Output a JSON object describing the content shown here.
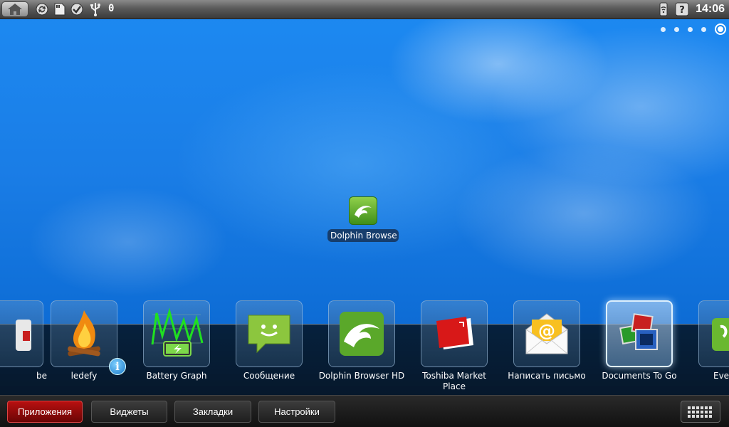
{
  "status_bar": {
    "icons": [
      "home-icon",
      "sync-icon",
      "sd-card-icon",
      "check-icon",
      "usb-icon"
    ],
    "notification_count": "0",
    "right_icons": [
      "wifi-icon",
      "help-icon"
    ],
    "clock": "14:06"
  },
  "home": {
    "page_count": 5,
    "active_page": 5
  },
  "desktop_shortcut": {
    "label": "Dolphin Browse",
    "icon": "dolphin-icon"
  },
  "dock": {
    "apps": [
      {
        "label": "be",
        "icon": "partial-app-icon"
      },
      {
        "label": "ledefy",
        "icon": "campfire-icon"
      },
      {
        "label": "Battery Graph",
        "icon": "battery-graph-icon"
      },
      {
        "label": "Сообщение",
        "icon": "message-icon"
      },
      {
        "label": "Dolphin Browser HD",
        "icon": "dolphin-icon"
      },
      {
        "label": "Toshiba Market Place",
        "icon": "market-icon"
      },
      {
        "label": "Написать письмо",
        "icon": "email-icon"
      },
      {
        "label": "Documents To Go",
        "icon": "documents-icon"
      },
      {
        "label": "Eve",
        "icon": "partial-app-icon"
      }
    ],
    "selected_index": 7
  },
  "tabs": [
    {
      "label": "Приложения",
      "active": true
    },
    {
      "label": "Виджеты",
      "active": false
    },
    {
      "label": "Закладки",
      "active": false
    },
    {
      "label": "Настройки",
      "active": false
    }
  ],
  "colors": {
    "accent_active_tab": "#b81010",
    "wallpaper_blue": "#1a7de6"
  }
}
